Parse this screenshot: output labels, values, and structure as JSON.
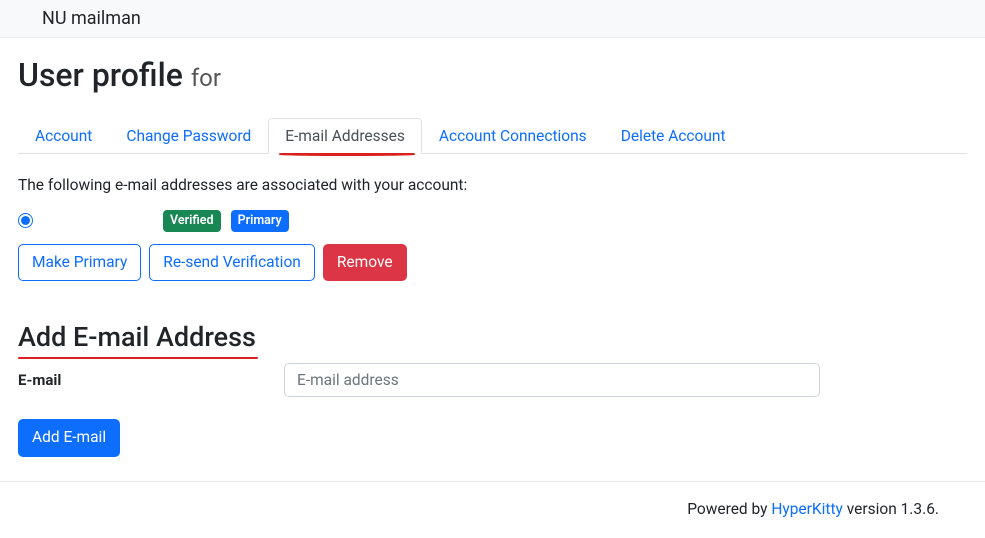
{
  "navbar": {
    "brand": "NU mailman"
  },
  "header": {
    "title": "User profile",
    "sub": "for"
  },
  "tabs": [
    {
      "label": "Account",
      "active": false
    },
    {
      "label": "Change Password",
      "active": false
    },
    {
      "label": "E-mail Addresses",
      "active": true
    },
    {
      "label": "Account Connections",
      "active": false
    },
    {
      "label": "Delete Account",
      "active": false
    }
  ],
  "intro": "The following e-mail addresses are associated with your account:",
  "emails": [
    {
      "address": "",
      "verified_label": "Verified",
      "primary_label": "Primary",
      "selected": true
    }
  ],
  "buttons": {
    "make_primary": "Make Primary",
    "resend": "Re-send Verification",
    "remove": "Remove"
  },
  "add_section": {
    "title": "Add E-mail Address",
    "label": "E-mail",
    "placeholder": "E-mail address",
    "submit": "Add E-mail"
  },
  "footer": {
    "prefix": "Powered by ",
    "link": "HyperKitty",
    "suffix": " version 1.3.6."
  }
}
